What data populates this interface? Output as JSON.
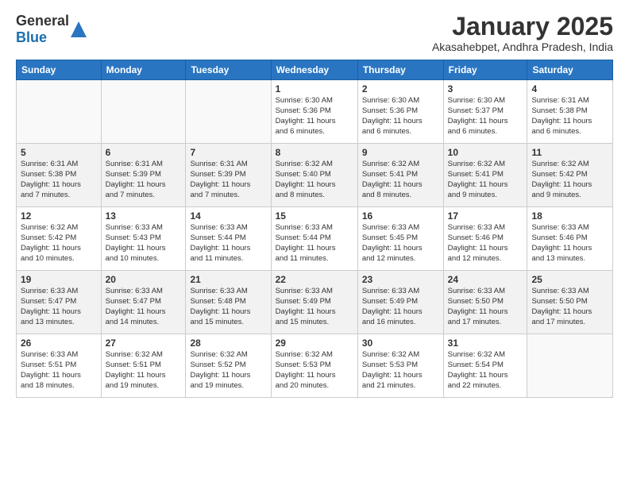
{
  "header": {
    "logo_general": "General",
    "logo_blue": "Blue",
    "month_title": "January 2025",
    "location": "Akasahebpet, Andhra Pradesh, India"
  },
  "weekdays": [
    "Sunday",
    "Monday",
    "Tuesday",
    "Wednesday",
    "Thursday",
    "Friday",
    "Saturday"
  ],
  "weeks": [
    [
      {
        "day": "",
        "info": ""
      },
      {
        "day": "",
        "info": ""
      },
      {
        "day": "",
        "info": ""
      },
      {
        "day": "1",
        "info": "Sunrise: 6:30 AM\nSunset: 5:36 PM\nDaylight: 11 hours\nand 6 minutes."
      },
      {
        "day": "2",
        "info": "Sunrise: 6:30 AM\nSunset: 5:36 PM\nDaylight: 11 hours\nand 6 minutes."
      },
      {
        "day": "3",
        "info": "Sunrise: 6:30 AM\nSunset: 5:37 PM\nDaylight: 11 hours\nand 6 minutes."
      },
      {
        "day": "4",
        "info": "Sunrise: 6:31 AM\nSunset: 5:38 PM\nDaylight: 11 hours\nand 6 minutes."
      }
    ],
    [
      {
        "day": "5",
        "info": "Sunrise: 6:31 AM\nSunset: 5:38 PM\nDaylight: 11 hours\nand 7 minutes."
      },
      {
        "day": "6",
        "info": "Sunrise: 6:31 AM\nSunset: 5:39 PM\nDaylight: 11 hours\nand 7 minutes."
      },
      {
        "day": "7",
        "info": "Sunrise: 6:31 AM\nSunset: 5:39 PM\nDaylight: 11 hours\nand 7 minutes."
      },
      {
        "day": "8",
        "info": "Sunrise: 6:32 AM\nSunset: 5:40 PM\nDaylight: 11 hours\nand 8 minutes."
      },
      {
        "day": "9",
        "info": "Sunrise: 6:32 AM\nSunset: 5:41 PM\nDaylight: 11 hours\nand 8 minutes."
      },
      {
        "day": "10",
        "info": "Sunrise: 6:32 AM\nSunset: 5:41 PM\nDaylight: 11 hours\nand 9 minutes."
      },
      {
        "day": "11",
        "info": "Sunrise: 6:32 AM\nSunset: 5:42 PM\nDaylight: 11 hours\nand 9 minutes."
      }
    ],
    [
      {
        "day": "12",
        "info": "Sunrise: 6:32 AM\nSunset: 5:42 PM\nDaylight: 11 hours\nand 10 minutes."
      },
      {
        "day": "13",
        "info": "Sunrise: 6:33 AM\nSunset: 5:43 PM\nDaylight: 11 hours\nand 10 minutes."
      },
      {
        "day": "14",
        "info": "Sunrise: 6:33 AM\nSunset: 5:44 PM\nDaylight: 11 hours\nand 11 minutes."
      },
      {
        "day": "15",
        "info": "Sunrise: 6:33 AM\nSunset: 5:44 PM\nDaylight: 11 hours\nand 11 minutes."
      },
      {
        "day": "16",
        "info": "Sunrise: 6:33 AM\nSunset: 5:45 PM\nDaylight: 11 hours\nand 12 minutes."
      },
      {
        "day": "17",
        "info": "Sunrise: 6:33 AM\nSunset: 5:46 PM\nDaylight: 11 hours\nand 12 minutes."
      },
      {
        "day": "18",
        "info": "Sunrise: 6:33 AM\nSunset: 5:46 PM\nDaylight: 11 hours\nand 13 minutes."
      }
    ],
    [
      {
        "day": "19",
        "info": "Sunrise: 6:33 AM\nSunset: 5:47 PM\nDaylight: 11 hours\nand 13 minutes."
      },
      {
        "day": "20",
        "info": "Sunrise: 6:33 AM\nSunset: 5:47 PM\nDaylight: 11 hours\nand 14 minutes."
      },
      {
        "day": "21",
        "info": "Sunrise: 6:33 AM\nSunset: 5:48 PM\nDaylight: 11 hours\nand 15 minutes."
      },
      {
        "day": "22",
        "info": "Sunrise: 6:33 AM\nSunset: 5:49 PM\nDaylight: 11 hours\nand 15 minutes."
      },
      {
        "day": "23",
        "info": "Sunrise: 6:33 AM\nSunset: 5:49 PM\nDaylight: 11 hours\nand 16 minutes."
      },
      {
        "day": "24",
        "info": "Sunrise: 6:33 AM\nSunset: 5:50 PM\nDaylight: 11 hours\nand 17 minutes."
      },
      {
        "day": "25",
        "info": "Sunrise: 6:33 AM\nSunset: 5:50 PM\nDaylight: 11 hours\nand 17 minutes."
      }
    ],
    [
      {
        "day": "26",
        "info": "Sunrise: 6:33 AM\nSunset: 5:51 PM\nDaylight: 11 hours\nand 18 minutes."
      },
      {
        "day": "27",
        "info": "Sunrise: 6:32 AM\nSunset: 5:51 PM\nDaylight: 11 hours\nand 19 minutes."
      },
      {
        "day": "28",
        "info": "Sunrise: 6:32 AM\nSunset: 5:52 PM\nDaylight: 11 hours\nand 19 minutes."
      },
      {
        "day": "29",
        "info": "Sunrise: 6:32 AM\nSunset: 5:53 PM\nDaylight: 11 hours\nand 20 minutes."
      },
      {
        "day": "30",
        "info": "Sunrise: 6:32 AM\nSunset: 5:53 PM\nDaylight: 11 hours\nand 21 minutes."
      },
      {
        "day": "31",
        "info": "Sunrise: 6:32 AM\nSunset: 5:54 PM\nDaylight: 11 hours\nand 22 minutes."
      },
      {
        "day": "",
        "info": ""
      }
    ]
  ]
}
